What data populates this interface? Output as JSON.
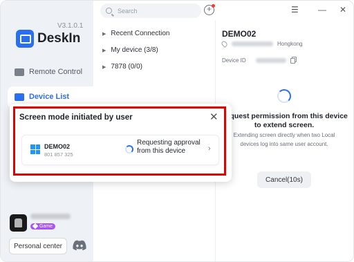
{
  "app": {
    "name": "DeskIn",
    "version": "V3.1.0.1"
  },
  "sidebar": {
    "items": [
      {
        "label": "Remote Control",
        "icon": "monitor-icon"
      },
      {
        "label": "Device List",
        "icon": "device-list-icon",
        "active": true
      }
    ],
    "profile": {
      "badge": "Game"
    },
    "personal_center": "Personal center",
    "discord_icon": "discord-icon"
  },
  "search": {
    "placeholder": "Search"
  },
  "groups": [
    {
      "label": "Recent Connection"
    },
    {
      "label": "My device (3/8)"
    },
    {
      "label": "7878 (0/0)"
    }
  ],
  "device_panel": {
    "name": "DEMO02",
    "location": "Hongkong",
    "device_id_label": "Device ID",
    "request_title": "Request permission from this device to extend screen.",
    "request_desc": "Extending screen directly when two Local devices log into same user account.",
    "cancel_label": "Cancel(10s)"
  },
  "popup": {
    "title": "Screen mode initiated by user",
    "device_name": "DEMO02",
    "device_id": "801 857 325",
    "status": "Requesting approval from this device"
  },
  "colors": {
    "accent": "#2a6ef2",
    "highlight": "#e00000",
    "notification_dot": "#f03b3b"
  }
}
